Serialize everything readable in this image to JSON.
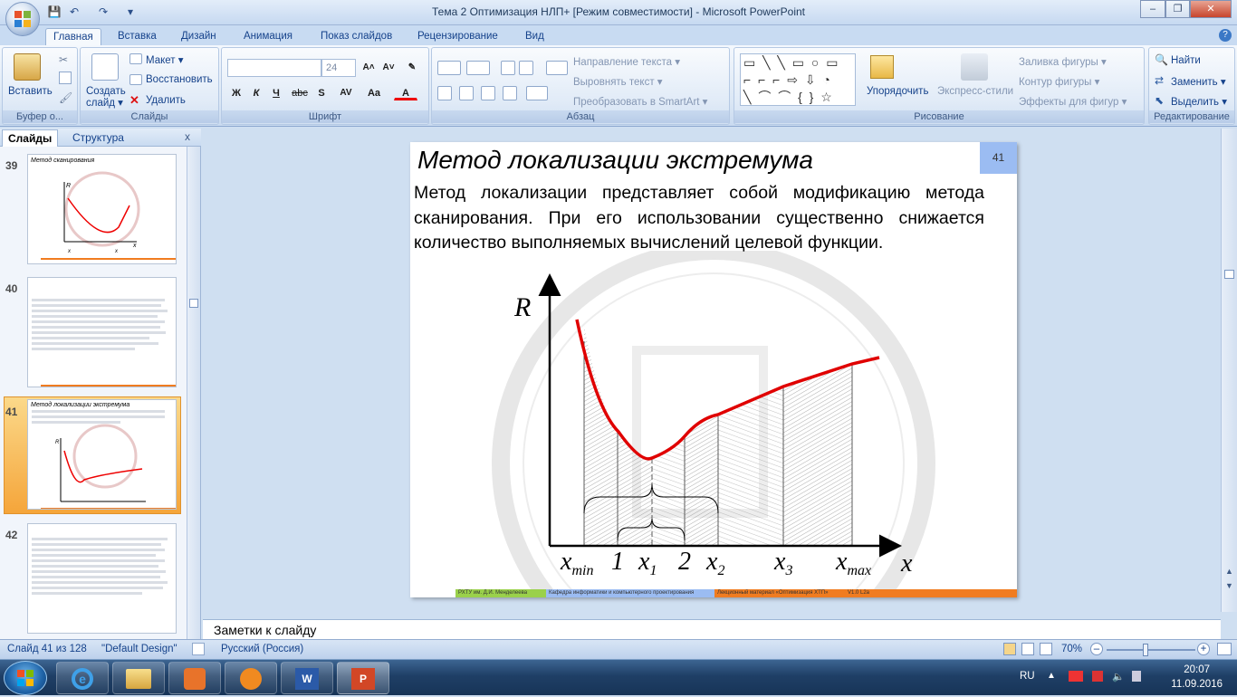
{
  "window": {
    "title": "Тема 2 Оптимизация НЛП+ [Режим совместимости] - Microsoft PowerPoint",
    "controls": {
      "minimize": "–",
      "restore": "❐",
      "close": "✕"
    }
  },
  "quick_access": {
    "save": "💾",
    "undo": "↶",
    "redo": "↷",
    "more": "▾"
  },
  "ribbon_tabs": [
    "Главная",
    "Вставка",
    "Дизайн",
    "Анимация",
    "Показ слайдов",
    "Рецензирование",
    "Вид"
  ],
  "ribbon": {
    "clipboard": {
      "paste": "Вставить",
      "label": "Буфер о..."
    },
    "slides": {
      "new_slide": "Создать слайд ▾",
      "layout": "Макет ▾",
      "reset": "Восстановить",
      "delete": "Удалить",
      "label": "Слайды"
    },
    "font": {
      "size": "24",
      "label": "Шрифт",
      "bold": "Ж",
      "italic": "К",
      "underline": "Ч",
      "strike": "abc",
      "shadow": "S",
      "spacing": "AV",
      "case": "Aa",
      "color": "A"
    },
    "paragraph": {
      "text_direction": "Направление текста ▾",
      "align_text": "Выровнять текст ▾",
      "smartart": "Преобразовать в SmartArt ▾",
      "label": "Абзац"
    },
    "drawing": {
      "arrange": "Упорядочить",
      "quick_styles": "Экспресс-стили",
      "fill": "Заливка фигуры ▾",
      "outline": "Контур фигуры ▾",
      "effects": "Эффекты для фигур ▾",
      "label": "Рисование"
    },
    "editing": {
      "find": "Найти",
      "replace": "Заменить ▾",
      "select": "Выделить ▾",
      "label": "Редактирование"
    }
  },
  "left_pane": {
    "tabs": [
      "Слайды",
      "Структура"
    ],
    "close": "x",
    "thumbs": [
      {
        "num": "39",
        "title": "Метод сканирования",
        "labels": [
          "R",
          "x",
          "x",
          "x"
        ]
      },
      {
        "num": "40",
        "title": ""
      },
      {
        "num": "41",
        "title": "Метод локализации экстремума"
      },
      {
        "num": "42",
        "title": ""
      }
    ]
  },
  "slide": {
    "number": "41",
    "title": "Метод локализации экстремума",
    "body": "Метод локализации представляет собой модификацию метода сканирования. При его использовании существенно снижается количество выполняемых вычислений целевой функции.",
    "graph": {
      "y_axis_label": "R",
      "x_axis_label": "x",
      "tick_labels": [
        {
          "main": "x",
          "sub": "min"
        },
        {
          "main": "1",
          "sub": ""
        },
        {
          "main": "x",
          "sub": "1"
        },
        {
          "main": "2",
          "sub": ""
        },
        {
          "main": "x",
          "sub": "2"
        },
        {
          "main": "x",
          "sub": "3"
        },
        {
          "main": "x",
          "sub": "max"
        }
      ],
      "curve_color": "#e00000"
    },
    "footer": [
      {
        "text": "РХТУ им. Д.И. Менделеева",
        "color": "#9ad14b"
      },
      {
        "text": "Кафедра информатики и компьютерного проектирования",
        "color": "#9bbcf2"
      },
      {
        "text": "Лекционный материал «Оптимизация ХТП»",
        "color": "#f07c20"
      },
      {
        "text": "V1.0 L2a",
        "color": "#f07c20"
      }
    ]
  },
  "notes": {
    "placeholder": "Заметки к слайду"
  },
  "status_bar": {
    "slide_info": "Слайд 41 из 128",
    "theme": "\"Default Design\"",
    "language": "Русский (Россия)",
    "zoom": "70%"
  },
  "taskbar": {
    "lang": "RU",
    "time": "20:07",
    "date": "11.09.2016"
  }
}
